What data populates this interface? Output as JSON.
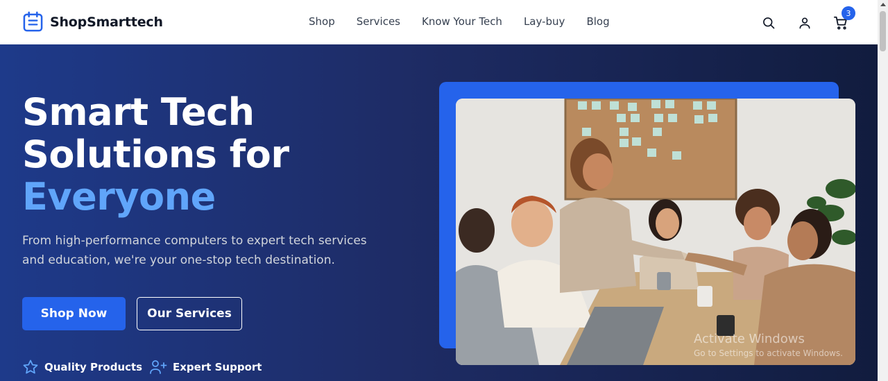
{
  "brand": {
    "name": "ShopSmarttech",
    "icon": "calendar-logo-icon"
  },
  "nav": {
    "items": [
      "Shop",
      "Services",
      "Know Your Tech",
      "Lay-buy",
      "Blog"
    ]
  },
  "header_icons": {
    "search": "search-icon",
    "account": "user-icon",
    "cart": "cart-icon",
    "cart_count": "3"
  },
  "hero": {
    "title_line1": "Smart Tech",
    "title_line2": "Solutions for",
    "title_accent": "Everyone",
    "subtitle": "From high-performance computers to expert tech services and education, we're your one-stop tech destination.",
    "primary_button": "Shop Now",
    "secondary_button": "Our Services",
    "features": [
      {
        "label": "Quality Products",
        "icon": "star-icon"
      },
      {
        "label": "Expert Support",
        "icon": "user-plus-icon"
      }
    ]
  },
  "colors": {
    "accent": "#2563eb",
    "accent_light": "#60a5fa",
    "hero_start": "#1e3a8a",
    "hero_end": "#111c3e"
  },
  "watermark": {
    "line1": "Activate Windows",
    "line2": "Go to Settings to activate Windows."
  }
}
